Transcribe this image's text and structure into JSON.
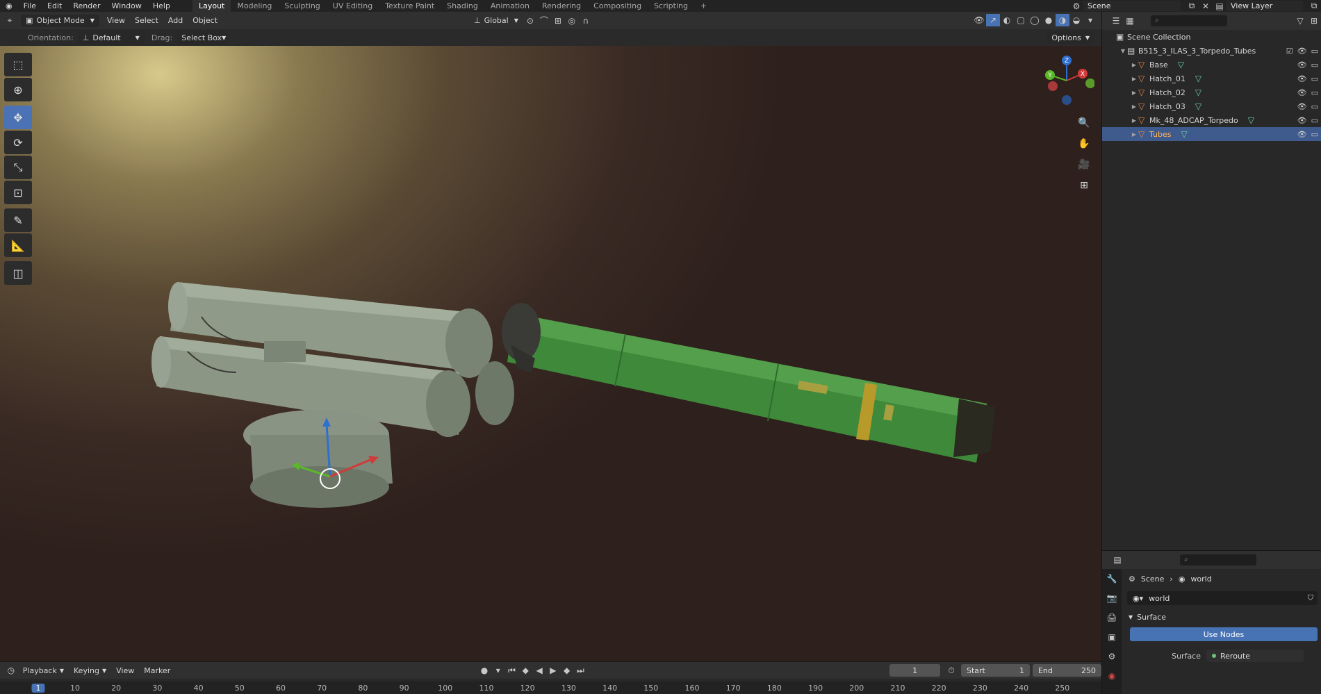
{
  "topbar": {
    "menus": [
      "File",
      "Edit",
      "Render",
      "Window",
      "Help"
    ],
    "workspaces": [
      "Layout",
      "Modeling",
      "Sculpting",
      "UV Editing",
      "Texture Paint",
      "Shading",
      "Animation",
      "Rendering",
      "Compositing",
      "Scripting"
    ],
    "active_workspace": "Layout",
    "add_workspace": "+",
    "scene": "Scene",
    "view_layer": "View Layer"
  },
  "viewport_header": {
    "mode": "Object Mode",
    "menus": [
      "View",
      "Select",
      "Add",
      "Object"
    ],
    "transform_orientation": "Global"
  },
  "tool_settings": {
    "orientation_label": "Orientation:",
    "orientation_value": "Default",
    "drag_label": "Drag:",
    "drag_value": "Select Box",
    "options": "Options"
  },
  "gizmo": {
    "z": "Z",
    "y": "Y",
    "x": "X"
  },
  "outliner": {
    "root": "Scene Collection",
    "collection": "B515_3_ILAS_3_Torpedo_Tubes",
    "objects": [
      "Base",
      "Hatch_01",
      "Hatch_02",
      "Hatch_03",
      "Mk_48_ADCAP_Torpedo",
      "Tubes"
    ],
    "selected": "Tubes"
  },
  "properties": {
    "breadcrumb_scene": "Scene",
    "breadcrumb_world": "world",
    "world_name": "world",
    "section": "Surface",
    "use_nodes": "Use Nodes",
    "surface_label": "Surface",
    "surface_value": "Reroute"
  },
  "timeline": {
    "menus": [
      "Playback",
      "Keying",
      "View",
      "Marker"
    ],
    "current_frame": "1",
    "start_label": "Start",
    "start_value": "1",
    "end_label": "End",
    "end_value": "250",
    "ticks": [
      "1",
      "10",
      "20",
      "30",
      "40",
      "50",
      "60",
      "70",
      "80",
      "90",
      "100",
      "110",
      "120",
      "130",
      "140",
      "150",
      "160",
      "170",
      "180",
      "190",
      "200",
      "210",
      "220",
      "230",
      "240",
      "250"
    ]
  },
  "colors": {
    "accent": "#4772b3",
    "selected_text": "#ffb45a",
    "object_icon": "#e8874a",
    "mesh_icon": "#6fd0a6",
    "torpedo_green": "#3f8a3a",
    "tube_gray": "#8f9a88"
  }
}
